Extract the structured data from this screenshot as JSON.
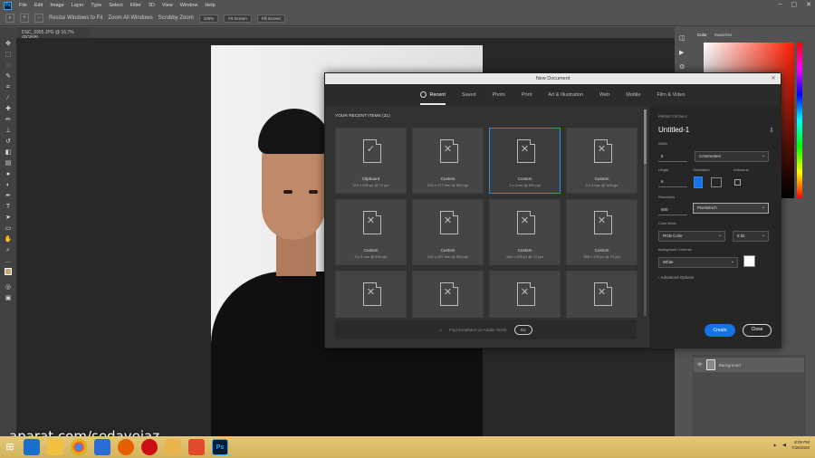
{
  "app": {
    "logo": "Ps",
    "menus": [
      "File",
      "Edit",
      "Image",
      "Layer",
      "Type",
      "Select",
      "Filter",
      "3D",
      "View",
      "Window",
      "Help"
    ]
  },
  "options_bar": {
    "items": [
      "Resize Windows to Fit",
      "Zoom All Windows",
      "Scrubby Zoom",
      "100%",
      "Fit Screen",
      "Fill Screen"
    ]
  },
  "doc_tab": {
    "label": "DSC_0955.JPG @ 16.7% (RGB/8)"
  },
  "right_panel": {
    "tabs": [
      "Color",
      "Swatches"
    ],
    "layer_name": "Background"
  },
  "dialog": {
    "title": "New Document",
    "tabs": [
      "Recent",
      "Saved",
      "Photo",
      "Print",
      "Art & Illustration",
      "Web",
      "Mobile",
      "Film & Video"
    ],
    "recent_title": "YOUR RECENT ITEMS  (21)",
    "items": [
      {
        "name": "Clipboard",
        "size": "370 x 625 px @ 72 ppi",
        "icon": "check"
      },
      {
        "name": "Custom",
        "size": "210 x 277 mm @ 600 ppi",
        "icon": "x"
      },
      {
        "name": "Custom",
        "size": "3 x 4 cm @ 600 ppi",
        "icon": "x"
      },
      {
        "name": "Custom",
        "size": "2 x 3 mm @ 300 ppi",
        "icon": "x"
      },
      {
        "name": "Custom",
        "size": "3 x 3 mm @ 600 ppi",
        "icon": "x"
      },
      {
        "name": "Custom",
        "size": "210 x 297 mm @ 300 ppi",
        "icon": "x"
      },
      {
        "name": "Custom",
        "size": "600 x 200 px @ 72 ppi",
        "icon": "x"
      },
      {
        "name": "Custom",
        "size": "300 x 200 px @ 72 ppi",
        "icon": "x"
      },
      {
        "name": "",
        "size": "",
        "icon": "x"
      },
      {
        "name": "",
        "size": "",
        "icon": "x"
      },
      {
        "name": "",
        "size": "",
        "icon": "x"
      },
      {
        "name": "",
        "size": "",
        "icon": "x"
      }
    ],
    "search_placeholder": "Find templates on Adobe Stock",
    "go_label": "Go",
    "details": {
      "header": "PRESET DETAILS",
      "doc_name": "Untitled-1",
      "width_label": "Width",
      "width_value": "5",
      "width_unit": "Centimeters",
      "height_label": "Height",
      "height_value": "6",
      "orientation_label": "Orientation",
      "artboards_label": "Artboards",
      "resolution_label": "Resolution",
      "resolution_value": "600",
      "resolution_unit": "Pixels/Inch",
      "color_mode_label": "Color Mode",
      "color_mode_value": "RGB Color",
      "bit_depth": "8 bit",
      "bg_label": "Background Contents",
      "bg_value": "White",
      "advanced": "Advanced Options"
    },
    "create_label": "Create",
    "close_label": "Close"
  },
  "watermark": "aparat.com/sedayejaz",
  "taskbar": {
    "apps": [
      "IE",
      "Explorer",
      "Chrome",
      "Media",
      "Firefox",
      "Opera",
      "Folder",
      "Corel",
      "Ps"
    ],
    "clock_time": "8:09 PM",
    "clock_date": "7/16/2020"
  },
  "colors": {
    "accent": "#1473e6",
    "selection": "#2d8ceb"
  }
}
